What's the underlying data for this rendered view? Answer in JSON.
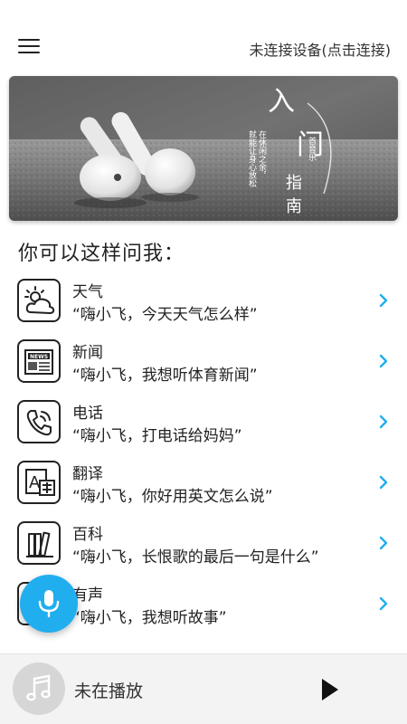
{
  "header": {
    "menu_icon": "menu-icon",
    "connection_status": "未连接设备(点击连接)"
  },
  "banner": {
    "title_char1": "入",
    "title_char2": "门",
    "subtitle": "指南",
    "poem_line1": "在休闲之余，",
    "poem_line2": "就能让身心放松",
    "poem_line3": "一首音乐"
  },
  "section_title": "你可以这样问我：",
  "items": [
    {
      "title": "天气",
      "example": "“嗨小飞，今天天气怎么样”",
      "icon": "weather-icon"
    },
    {
      "title": "新闻",
      "example": "“嗨小飞，我想听体育新闻”",
      "icon": "news-icon"
    },
    {
      "title": "电话",
      "example": "“嗨小飞，打电话给妈妈”",
      "icon": "phone-icon"
    },
    {
      "title": "翻译",
      "example": "“嗨小飞，你好用英文怎么说”",
      "icon": "translate-icon"
    },
    {
      "title": "百科",
      "example": "“嗨小飞，长恨歌的最后一句是什么”",
      "icon": "books-icon"
    },
    {
      "title": "有声",
      "example": "“嗨小飞，我想听故事”",
      "icon": "audio-icon"
    }
  ],
  "player": {
    "status": "未在播放",
    "album_icon": "music-note-icon",
    "play_icon": "play-icon"
  },
  "fab": {
    "icon": "microphone-icon"
  },
  "colors": {
    "accent": "#21aeef",
    "text": "#222222",
    "player_bg": "#f3f3f3"
  }
}
